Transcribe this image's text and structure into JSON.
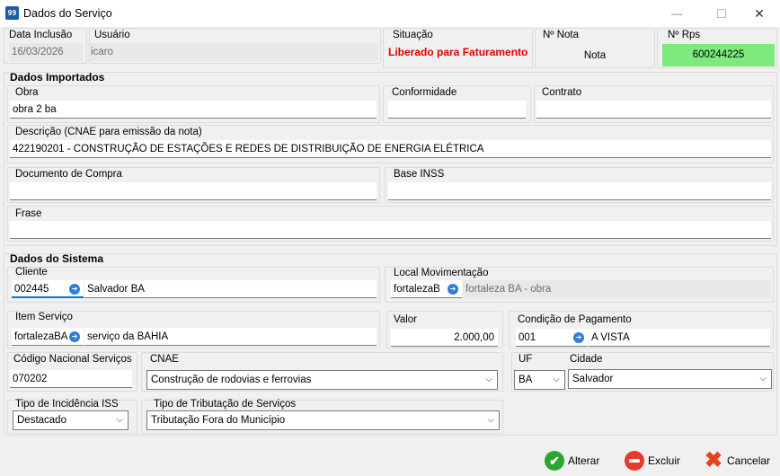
{
  "window": {
    "title": "Dados do Serviço",
    "icon_text": "99"
  },
  "header": {
    "data_inclusao": {
      "label": "Data Inclusão",
      "value": "16/03/2026"
    },
    "usuario": {
      "label": "Usuário",
      "value": "icaro"
    },
    "situacao": {
      "label": "Situação",
      "value": "Liberado para Faturamento"
    },
    "nota": {
      "label": "Nº Nota",
      "value": "Nota"
    },
    "rps": {
      "label": "Nº Rps",
      "value": "600244225"
    }
  },
  "importados": {
    "section": "Dados Importados",
    "obra": {
      "label": "Obra",
      "value": "obra 2 ba"
    },
    "conformidade": {
      "label": "Conformidade",
      "value": ""
    },
    "contrato": {
      "label": "Contrato",
      "value": ""
    },
    "descricao": {
      "label": "Descrição (CNAE para emissão da nota)",
      "value": "422190201 - CONSTRUÇÃO DE ESTAÇÕES E REDES DE DISTRIBUIÇÃO DE ENERGIA ELÉTRICA"
    },
    "documento": {
      "label": "Documento de Compra",
      "value": ""
    },
    "base_inss": {
      "label": "Base INSS",
      "value": ""
    },
    "frase": {
      "label": "Frase",
      "value": ""
    }
  },
  "sistema": {
    "section": "Dados do Sistema",
    "cliente": {
      "label": "Cliente",
      "code": "002445",
      "name": "Salvador BA"
    },
    "local": {
      "label": "Local Movimentação",
      "code": "fortalezaB",
      "name": "fortaleza BA - obra"
    },
    "item": {
      "label": "Item Serviço",
      "code": "fortalezaBA",
      "name": "serviço da BAHIA"
    },
    "valor": {
      "label": "Valor",
      "value": "2.000,00"
    },
    "condicao": {
      "label": "Condição de Pagamento",
      "code": "001",
      "name": "A VISTA"
    },
    "codigo_nacional": {
      "label": "Código Nacional Serviços",
      "value": "070202"
    },
    "cnae": {
      "label": "CNAE",
      "value": "Construção de rodovias e ferrovias"
    },
    "uf": {
      "label": "UF",
      "value": "BA"
    },
    "cidade": {
      "label": "Cidade",
      "value": "Salvador"
    },
    "incidencia": {
      "label": "Tipo de Incidência ISS",
      "value": "Destacado"
    },
    "tributacao": {
      "label": "Tipo de Tributação de Serviços",
      "value": "Tributação Fora do Município"
    }
  },
  "buttons": {
    "alterar": "Alterar",
    "excluir": "Excluir",
    "cancelar": "Cancelar"
  },
  "colors": {
    "rps_bg": "#7eea7e",
    "status_red": "#e00000",
    "lookup_blue": "#2f7ed8"
  }
}
